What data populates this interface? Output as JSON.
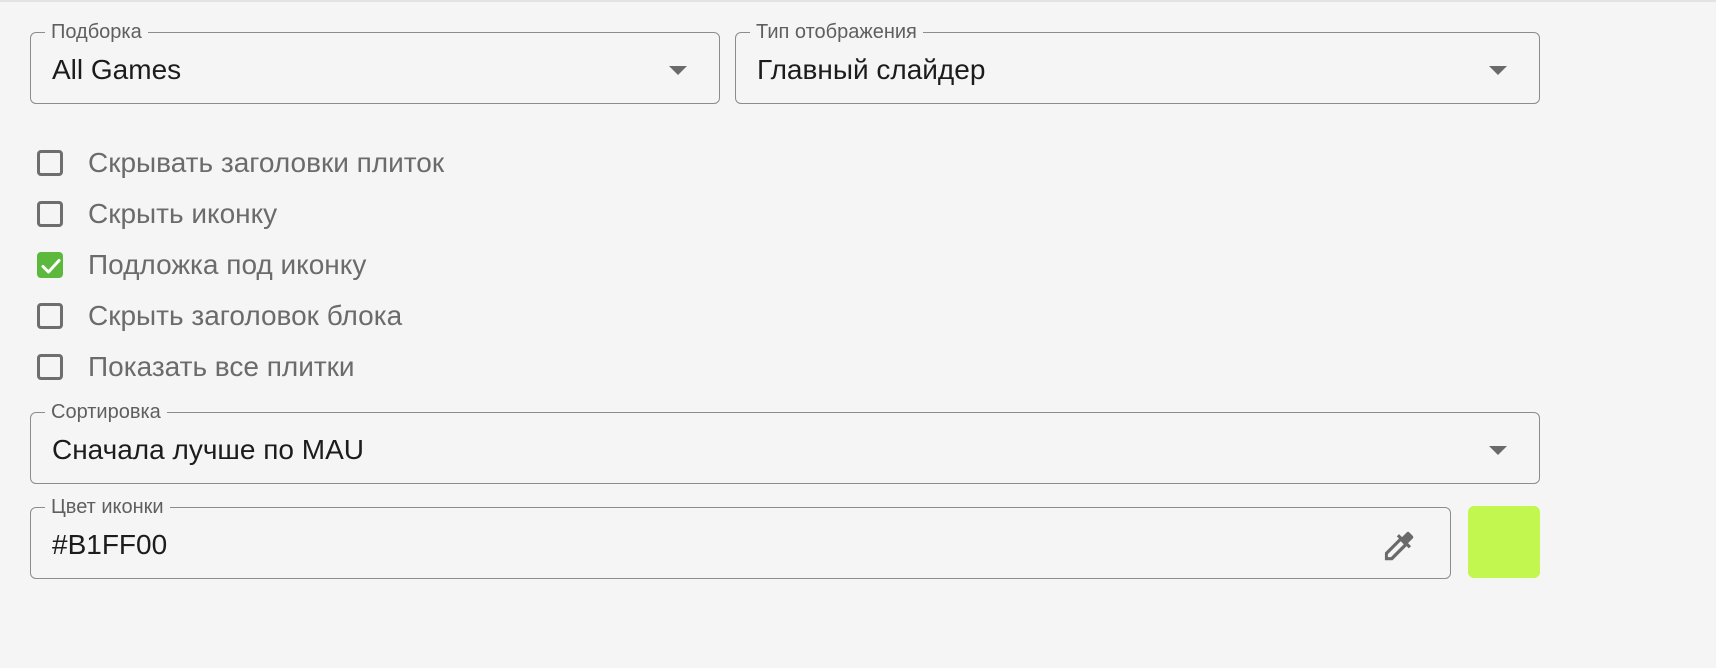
{
  "selection": {
    "label": "Подборка",
    "value": "All Games"
  },
  "display_type": {
    "label": "Тип отображения",
    "value": "Главный слайдер"
  },
  "checkboxes": [
    {
      "label": "Скрывать заголовки плиток",
      "checked": false
    },
    {
      "label": "Скрыть иконку",
      "checked": false
    },
    {
      "label": "Подложка под иконку",
      "checked": true
    },
    {
      "label": "Скрыть заголовок блока",
      "checked": false
    },
    {
      "label": "Показать все плитки",
      "checked": false
    }
  ],
  "sorting": {
    "label": "Сортировка",
    "value": "Сначала лучше по MAU"
  },
  "icon_color": {
    "label": "Цвет иконки",
    "value": "#B1FF00",
    "swatch_color": "#c2f74f",
    "eyedropper_icon": "eyedropper-icon"
  },
  "colors": {
    "checkbox_accent": "#5cb93e"
  }
}
